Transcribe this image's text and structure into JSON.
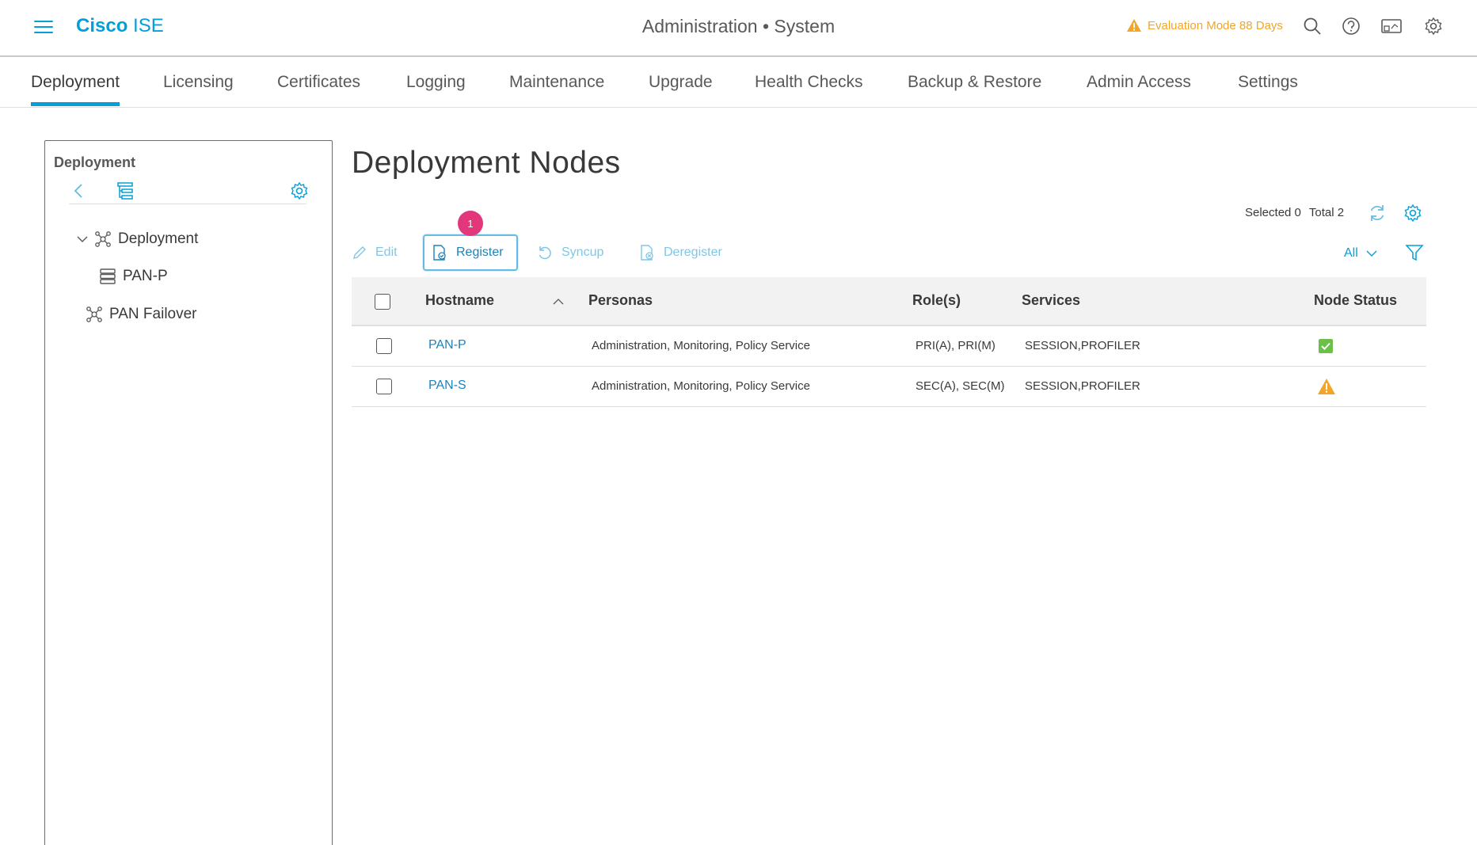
{
  "header": {
    "brand_bold": "Cisco",
    "brand_light": "ISE",
    "page_title": "Administration • System",
    "eval_text": "Evaluation Mode 88 Days"
  },
  "tabs": [
    {
      "label": "Deployment",
      "active": true
    },
    {
      "label": "Licensing"
    },
    {
      "label": "Certificates"
    },
    {
      "label": "Logging"
    },
    {
      "label": "Maintenance"
    },
    {
      "label": "Upgrade"
    },
    {
      "label": "Health Checks"
    },
    {
      "label": "Backup & Restore"
    },
    {
      "label": "Admin Access"
    },
    {
      "label": "Settings"
    }
  ],
  "sidebar": {
    "title": "Deployment",
    "tree": [
      {
        "label": "Deployment",
        "icon": "network-icon",
        "expanded": true
      },
      {
        "label": "PAN-P",
        "icon": "server-icon"
      },
      {
        "label": "PAN Failover",
        "icon": "network-icon"
      }
    ]
  },
  "main": {
    "title": "Deployment Nodes",
    "selected_label": "Selected 0",
    "total_label": "Total 2",
    "toolbar": {
      "edit": "Edit",
      "register": "Register",
      "syncup": "Syncup",
      "deregister": "Deregister",
      "register_badge": "1",
      "filter_all": "All"
    },
    "columns": {
      "hostname": "Hostname",
      "personas": "Personas",
      "roles": "Role(s)",
      "services": "Services",
      "node_status": "Node Status"
    },
    "rows": [
      {
        "hostname": "PAN-P",
        "personas": "Administration, Monitoring, Policy Service",
        "roles": "PRI(A), PRI(M)",
        "services": "SESSION,PROFILER",
        "status": "ok"
      },
      {
        "hostname": "PAN-S",
        "personas": "Administration, Monitoring, Policy Service",
        "roles": "SEC(A), SEC(M)",
        "services": "SESSION,PROFILER",
        "status": "warning"
      }
    ]
  },
  "colors": {
    "accent": "#049fd9",
    "warning": "#f2a527",
    "ok": "#6cc04a",
    "badge": "#e2377a"
  }
}
